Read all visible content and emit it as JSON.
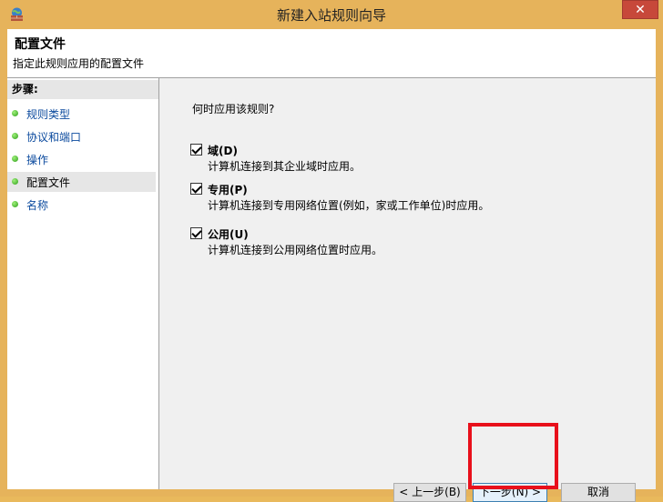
{
  "window": {
    "title": "新建入站规则向导",
    "app_icon": "firewall-globe-icon",
    "close_label": "✕"
  },
  "header": {
    "title": "配置文件",
    "subtitle": "指定此规则应用的配置文件"
  },
  "sidebar": {
    "steps_header": "步骤:",
    "items": [
      {
        "label": "规则类型",
        "state": "link"
      },
      {
        "label": "协议和端口",
        "state": "link"
      },
      {
        "label": "操作",
        "state": "link"
      },
      {
        "label": "配置文件",
        "state": "current"
      },
      {
        "label": "名称",
        "state": "link"
      }
    ]
  },
  "main": {
    "question": "何时应用该规则?",
    "options": [
      {
        "label": "域(D)",
        "description": "计算机连接到其企业域时应用。",
        "checked": true
      },
      {
        "label": "专用(P)",
        "description": "计算机连接到专用网络位置(例如，家或工作单位)时应用。",
        "checked": true
      },
      {
        "label": "公用(U)",
        "description": "计算机连接到公用网络位置时应用。",
        "checked": true
      }
    ]
  },
  "buttons": {
    "back": "< 上一步(B)",
    "next": "下一步(N) >",
    "cancel": "取消"
  },
  "colors": {
    "frame": "#e6b35b",
    "close": "#c7483a",
    "highlight": "#e8101b",
    "link": "#0b4a9e"
  }
}
